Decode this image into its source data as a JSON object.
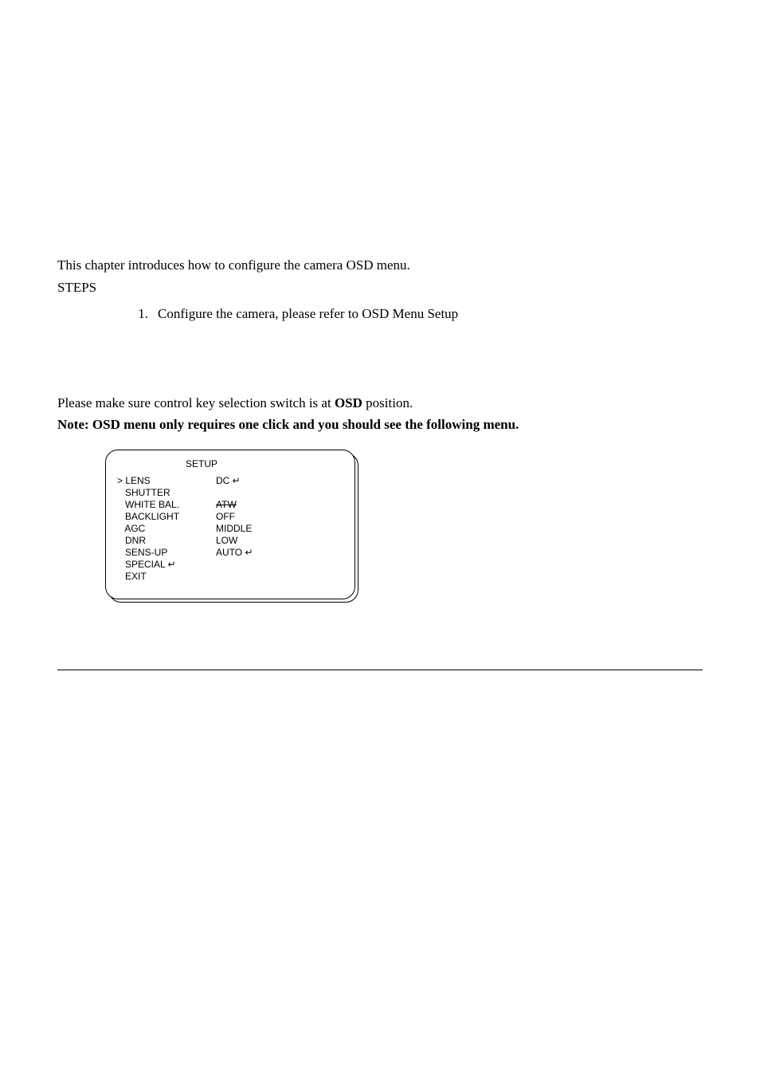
{
  "intro": "This chapter introduces how to configure the camera OSD menu.",
  "steps_label": "STEPS",
  "list": {
    "n1": "1.",
    "t1": "Configure the camera, please refer to OSD Menu Setup"
  },
  "para2": "Please make sure control key selection switch is at ",
  "para2_bold": "OSD",
  "para2_tail": " position.",
  "note": "Note: OSD menu only requires one click and you should see the following menu.",
  "osd": {
    "title": "SETUP",
    "rows": [
      {
        "l": "> LENS",
        "r": "DC ↵"
      },
      {
        "l": "   SHUTTER",
        "r": ""
      },
      {
        "l": "   WHITE BAL.",
        "r": "ATW",
        "strike": true
      },
      {
        "l": "   BACKLIGHT",
        "r": "OFF"
      },
      {
        "l": "   AGC",
        "r": "MIDDLE"
      },
      {
        "l": "   DNR",
        "r": "LOW"
      },
      {
        "l": "   SENS-UP",
        "r": "AUTO ↵"
      },
      {
        "l": "   SPECIAL ↵",
        "r": ""
      },
      {
        "l": "   EXIT",
        "r": ""
      }
    ]
  }
}
